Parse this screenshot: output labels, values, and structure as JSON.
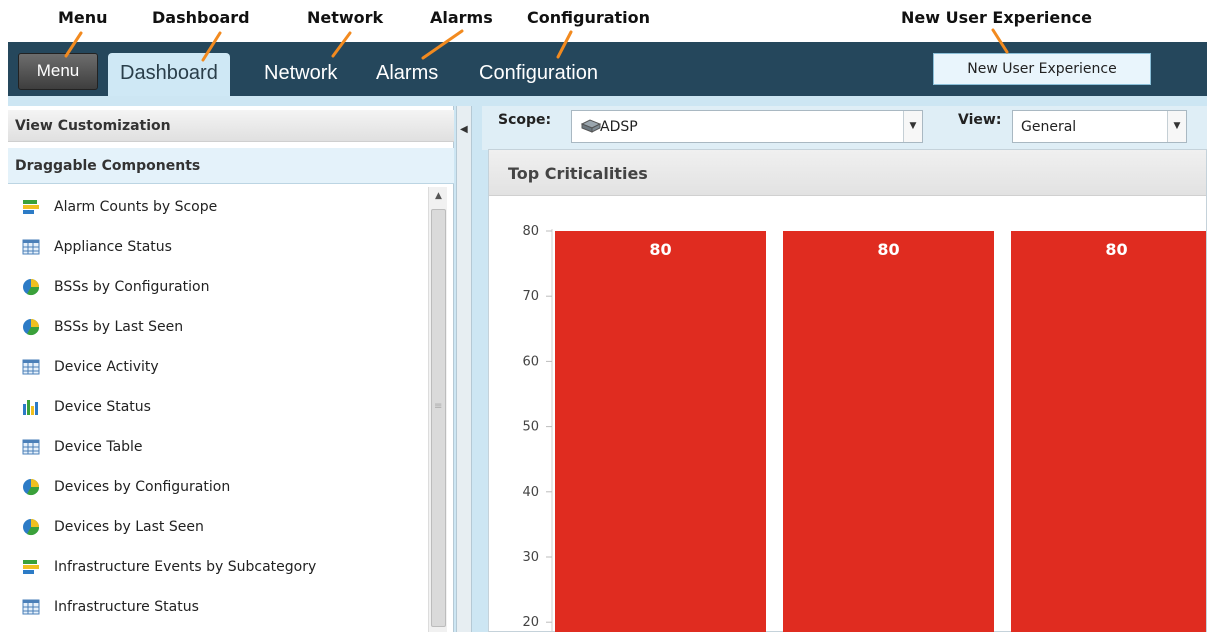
{
  "callouts": {
    "menu": "Menu",
    "dashboard": "Dashboard",
    "network": "Network",
    "alarms": "Alarms",
    "configuration": "Configuration",
    "new_user_experience": "New User Experience"
  },
  "navbar": {
    "menu_label": "Menu",
    "tabs": [
      {
        "label": "Dashboard",
        "active": true
      },
      {
        "label": "Network",
        "active": false
      },
      {
        "label": "Alarms",
        "active": false
      },
      {
        "label": "Configuration",
        "active": false
      }
    ],
    "new_user_experience_label": "New User Experience"
  },
  "sidebar": {
    "view_customization": "View Customization",
    "draggable_components": "Draggable Components",
    "items": [
      {
        "label": "Alarm Counts by Scope",
        "icon": "hbar-chart-icon"
      },
      {
        "label": "Appliance Status",
        "icon": "table-icon"
      },
      {
        "label": "BSSs by Configuration",
        "icon": "pie-chart-icon"
      },
      {
        "label": "BSSs by Last Seen",
        "icon": "pie-chart-icon"
      },
      {
        "label": "Device Activity",
        "icon": "table-icon"
      },
      {
        "label": "Device Status",
        "icon": "bar-chart-icon"
      },
      {
        "label": "Device Table",
        "icon": "table-icon"
      },
      {
        "label": "Devices by Configuration",
        "icon": "pie-chart-icon"
      },
      {
        "label": "Devices by Last Seen",
        "icon": "pie-chart-icon"
      },
      {
        "label": "Infrastructure Events by Subcategory",
        "icon": "hbar-chart-icon"
      },
      {
        "label": "Infrastructure Status",
        "icon": "table-icon"
      }
    ]
  },
  "toolbar": {
    "scope_label": "Scope:",
    "scope_value": "ADSP",
    "scope_icon": "server-icon",
    "view_label": "View:",
    "view_value": "General"
  },
  "panel": {
    "title": "Top Criticalities"
  },
  "colors": {
    "navbar": "#25475c",
    "active_tab": "#cfe8f5",
    "bar": "#e02c20",
    "callout_arrow": "#f28a1f"
  },
  "chart_data": {
    "type": "bar",
    "title": "Top Criticalities",
    "categories": [
      "",
      "",
      ""
    ],
    "values": [
      80,
      80,
      80
    ],
    "data_labels": [
      "80",
      "80",
      "80"
    ],
    "y_ticks": [
      20,
      30,
      40,
      50,
      60,
      70,
      80
    ],
    "ylim": [
      15,
      80
    ],
    "grid": false,
    "legend": "none"
  }
}
